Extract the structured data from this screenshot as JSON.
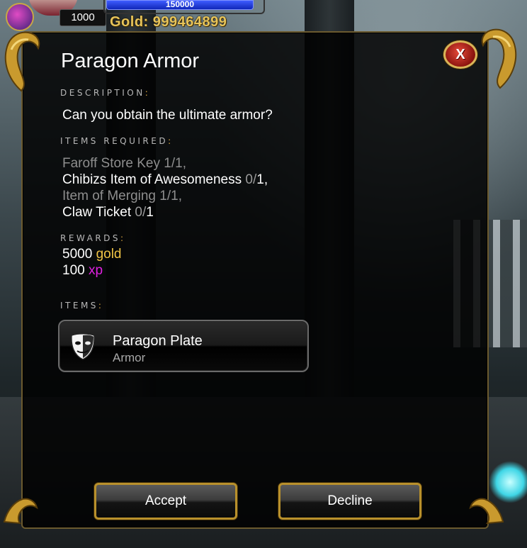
{
  "hud": {
    "level_value": "1000",
    "hp_value": "150000",
    "gold_label": "Gold:",
    "gold_value": "999464899"
  },
  "dialog": {
    "title": "Paragon Armor",
    "close_glyph": "X",
    "description_label": "DESCRIPTION",
    "description_text": "Can you obtain the ultimate armor?",
    "items_required_label": "ITEMS REQUIRED",
    "requirements": [
      {
        "name": "Faroff Store Key",
        "have": "1",
        "need": "1",
        "suffix": ",",
        "complete": true
      },
      {
        "name": "Chibizs Item of Awesomeness",
        "have": "0",
        "need": "1",
        "suffix": ",",
        "complete": false
      },
      {
        "name": "Item of Merging",
        "have": "1",
        "need": "1",
        "suffix": ",",
        "complete": true
      },
      {
        "name": "Claw Ticket",
        "have": "0",
        "need": "1",
        "suffix": "",
        "complete": false
      }
    ],
    "rewards_label": "REWARDS",
    "rewards": [
      {
        "amount": "5000",
        "unit": "gold"
      },
      {
        "amount": "100",
        "unit": "xp"
      }
    ],
    "items_label": "ITEMS",
    "item": {
      "name": "Paragon Plate",
      "type": "Armor",
      "icon": "armor-mask-icon"
    },
    "accept_label": "Accept",
    "decline_label": "Decline"
  },
  "colors": {
    "gold_text": "#e7c45a",
    "reward_gold": "#f0c445",
    "reward_xp": "#e020e0",
    "frame_gold": "#b8902c",
    "close_red": "#c0281e"
  }
}
